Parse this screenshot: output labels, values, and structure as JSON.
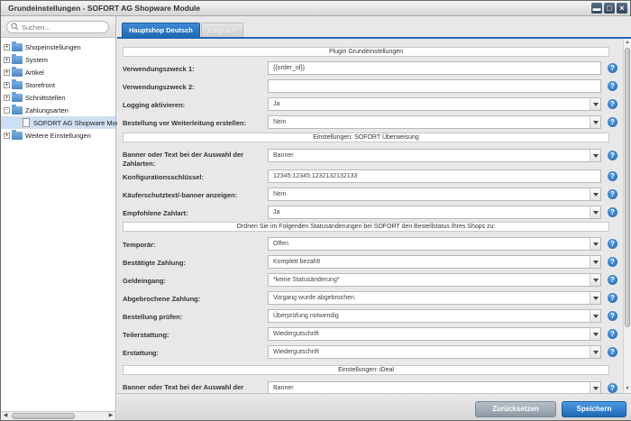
{
  "window": {
    "title": "Grundeinstellungen - SOFORT AG Shopware Module",
    "controls": [
      "minimize-icon",
      "maximize-icon",
      "close-icon"
    ]
  },
  "sidebar": {
    "search_placeholder": "Suchen...",
    "tree": [
      {
        "label": "Shopeinstellungen",
        "expander": "+"
      },
      {
        "label": "System",
        "expander": "+"
      },
      {
        "label": "Artikel",
        "expander": "+"
      },
      {
        "label": "Storefront",
        "expander": "+"
      },
      {
        "label": "Schnittstellen",
        "expander": "+"
      },
      {
        "label": "Zahlungsarten",
        "expander": "-"
      },
      {
        "label": "SOFORT AG Shopware Module",
        "child": true,
        "selected": true
      },
      {
        "label": "Weitere Einstellungen",
        "expander": "+"
      }
    ]
  },
  "tabs": [
    {
      "label": "Hauptshop Deutsch",
      "active": true
    },
    {
      "label": "Englisch",
      "active": false
    }
  ],
  "form": {
    "sections": {
      "plugin": "Plugin Grundeinstellungen",
      "ueberweisung": "Einstellungen: SOFORT Überweisung",
      "status": "Ordnen Sie im Folgenden Statusänderungen bei SOFORT den Bestellstatus Ihres Shops zu:",
      "ideal": "Einstellungen: iDeal"
    },
    "rows": {
      "vz1": {
        "label": "Verwendungszweck 1:",
        "value": "{{order_id}}"
      },
      "vz2": {
        "label": "Verwendungszweck 2:",
        "value": ""
      },
      "logging": {
        "label": "Logging aktivieren:",
        "value": "Ja"
      },
      "bestellung": {
        "label": "Bestellung vor Weiterleitung erstellen:",
        "value": "Nein"
      },
      "banner": {
        "label": "Banner oder Text bei der Auswahl der Zahlarten:",
        "value": "Banner"
      },
      "key": {
        "label": "Konfigurationsschlüssel:",
        "value": "12345:12345:1232132132133"
      },
      "kaeufer": {
        "label": "Käuferschutztext/-banner anzeigen:",
        "value": "Nein"
      },
      "empfohlen": {
        "label": "Empfohlene Zahlart:",
        "value": "Ja"
      },
      "temporaer": {
        "label": "Temporär:",
        "value": "Offen"
      },
      "bestaetigt": {
        "label": "Bestätigte Zahlung:",
        "value": "Komplett bezahlt"
      },
      "geldeingang": {
        "label": "Geldeingang:",
        "value": "*keine Statusänderung*"
      },
      "abgebrochen": {
        "label": "Abgebrochene Zahlung:",
        "value": "Vorgang wurde abgebrochen."
      },
      "pruefen": {
        "label": "Bestellung prüfen:",
        "value": "Überprüfung notwendig"
      },
      "teilerstattung": {
        "label": "Teilerstattung:",
        "value": "Wiedergutschrift"
      },
      "erstattung": {
        "label": "Erstattung:",
        "value": "Wiedergutschrift"
      },
      "banner_ideal": {
        "label": "Banner oder Text bei der Auswahl der Zahlarten:",
        "value": "Banner"
      }
    },
    "help_glyph": "?"
  },
  "footer": {
    "reset_label": "Zurücksetzen",
    "save_label": "Speichern"
  },
  "colors": {
    "accent": "#1f68b4",
    "tab_active": "#2d7ac6",
    "reset_button": "#9aa5b0"
  }
}
